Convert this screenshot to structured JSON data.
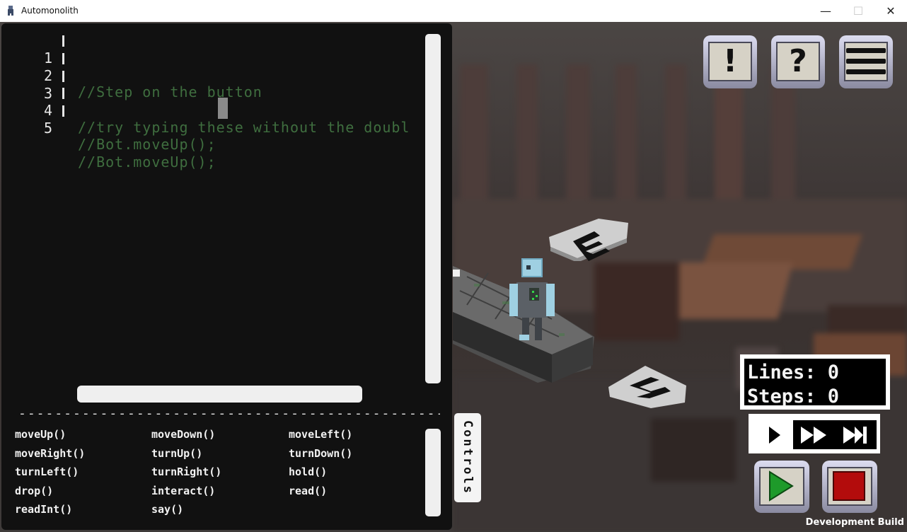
{
  "window": {
    "title": "Automonolith",
    "minimize_glyph": "—",
    "maximize_glyph": "☐",
    "close_glyph": "✕"
  },
  "editor": {
    "lines": [
      {
        "number": "1",
        "text": "//Step on the button"
      },
      {
        "number": "2",
        "text": ""
      },
      {
        "number": "3",
        "text": "//try typing these without the doubl"
      },
      {
        "number": "4",
        "text": "//Bot.moveUp();"
      },
      {
        "number": "5",
        "text": "//Bot.moveUp();"
      }
    ],
    "divider": "--------------------------------------------------"
  },
  "commands": [
    "moveUp()",
    "moveDown()",
    "moveLeft()",
    "moveRight()",
    "turnUp()",
    "turnDown()",
    "turnLeft()",
    "turnRight()",
    "hold()",
    "drop()",
    "interact()",
    "read()",
    "readInt()",
    "say()"
  ],
  "controls_tab": {
    "label": "Controls"
  },
  "hud": {
    "alert_glyph": "!",
    "help_glyph": "?",
    "icons": [
      "exclamation-icon",
      "question-icon",
      "menu-icon"
    ]
  },
  "stats": {
    "lines_label": "Lines: 0",
    "steps_label": "Steps: 0"
  },
  "speed": {
    "options": [
      "play-icon",
      "fast-forward-icon",
      "step-icon"
    ],
    "selected": "play-icon"
  },
  "run_controls": {
    "play_color": "#1e9a2a",
    "stop_color": "#b30c0c"
  },
  "footer": {
    "build_label": "Development Build"
  },
  "colors": {
    "code_comment": "#3f6e3f",
    "editor_bg": "#111111"
  }
}
